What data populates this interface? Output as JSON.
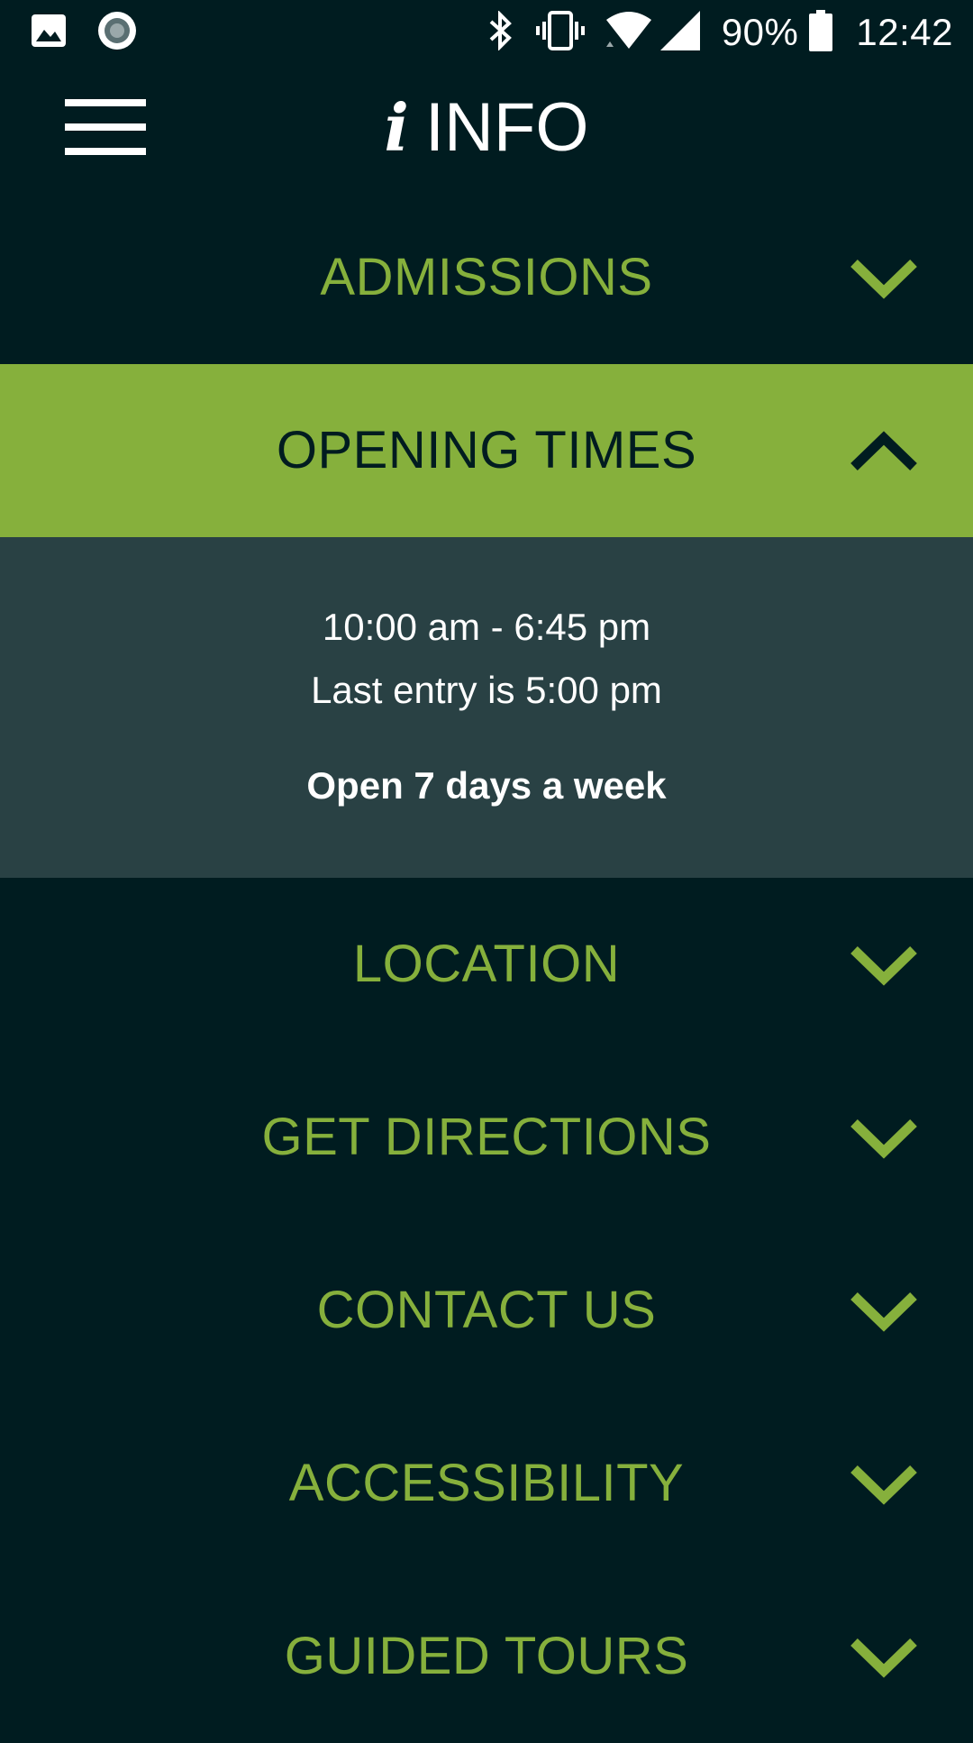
{
  "status_bar": {
    "battery_percent": "90%",
    "time": "12:42",
    "icons": [
      "image-notification-icon",
      "record-notification-icon",
      "bluetooth-icon",
      "vibrate-icon",
      "wifi-icon",
      "signal-icon",
      "battery-icon"
    ]
  },
  "header": {
    "icon": "info-icon",
    "icon_glyph": "i",
    "title": "INFO",
    "menu_icon": "hamburger-menu-icon"
  },
  "colors": {
    "background": "#001c20",
    "accent_green": "#86b03c",
    "panel": "#294144",
    "text_light": "#ffffff"
  },
  "accordion": {
    "items": [
      {
        "label": "ADMISSIONS",
        "expanded": false,
        "icon": "chevron-down-icon"
      },
      {
        "label": "OPENING TIMES",
        "expanded": true,
        "icon": "chevron-up-icon"
      },
      {
        "label": "LOCATION",
        "expanded": false,
        "icon": "chevron-down-icon"
      },
      {
        "label": "GET DIRECTIONS",
        "expanded": false,
        "icon": "chevron-down-icon"
      },
      {
        "label": "CONTACT US",
        "expanded": false,
        "icon": "chevron-down-icon"
      },
      {
        "label": "ACCESSIBILITY",
        "expanded": false,
        "icon": "chevron-down-icon"
      },
      {
        "label": "GUIDED TOURS",
        "expanded": false,
        "icon": "chevron-down-icon"
      }
    ],
    "opening_times": {
      "hours": "10:00 am - 6:45 pm",
      "last_entry": "Last entry is 5:00 pm",
      "open_days": "Open 7 days a week"
    }
  }
}
